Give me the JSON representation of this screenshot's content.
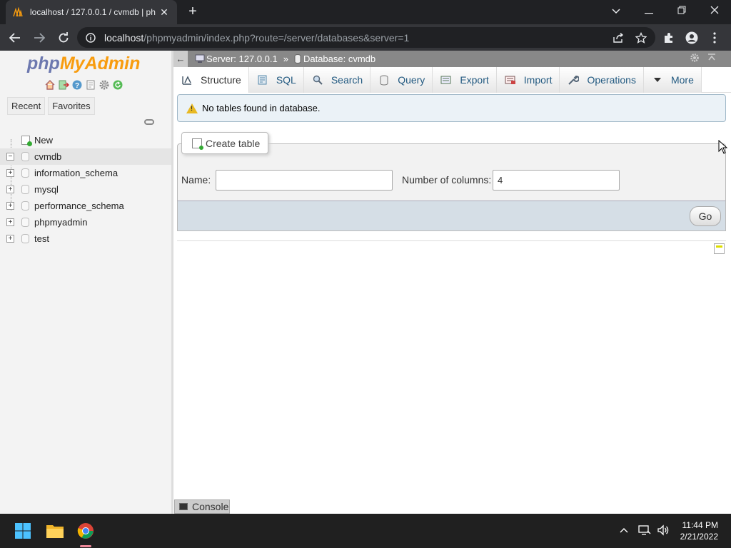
{
  "browser": {
    "tab_title": "localhost / 127.0.0.1 / cvmdb | ph",
    "tab_close": "✕",
    "new_tab": "+",
    "url_host": "localhost",
    "url_path": "/phpmyadmin/index.php?route=/server/databases&server=1",
    "window_controls": {
      "minimize": "—",
      "restore": "❐",
      "close": "✕",
      "dropdown": "⌄"
    }
  },
  "sidebar": {
    "logo": {
      "php": "php",
      "my": "My",
      "admin": "Admin"
    },
    "toolbar_icons": [
      "home-icon",
      "logout-icon",
      "help-icon",
      "docs-icon",
      "settings-icon",
      "reload-icon"
    ],
    "recent_tab": "Recent",
    "favorites_tab": "Favorites",
    "tree": [
      {
        "label": "New",
        "type": "new"
      },
      {
        "label": "cvmdb",
        "type": "db",
        "expanded": true,
        "selected": true
      },
      {
        "label": "information_schema",
        "type": "db"
      },
      {
        "label": "mysql",
        "type": "db"
      },
      {
        "label": "performance_schema",
        "type": "db"
      },
      {
        "label": "phpmyadmin",
        "type": "db"
      },
      {
        "label": "test",
        "type": "db"
      }
    ]
  },
  "breadcrumb": {
    "back": "←",
    "server": "Server: 127.0.0.1",
    "separator": "»",
    "database": "Database: cvmdb"
  },
  "tabs": [
    {
      "label": "Structure",
      "icon": "structure-icon",
      "active": true
    },
    {
      "label": "SQL",
      "icon": "sql-icon"
    },
    {
      "label": "Search",
      "icon": "search-icon"
    },
    {
      "label": "Query",
      "icon": "query-icon"
    },
    {
      "label": "Export",
      "icon": "export-icon"
    },
    {
      "label": "Import",
      "icon": "import-icon"
    },
    {
      "label": "Operations",
      "icon": "wrench-icon"
    },
    {
      "label": "More",
      "icon": "triangle-down-icon"
    }
  ],
  "notice": {
    "text": "No tables found in database."
  },
  "create_table": {
    "legend": "Create table",
    "name_label": "Name:",
    "name_value": "",
    "columns_label": "Number of columns:",
    "columns_value": "4",
    "go_button": "Go"
  },
  "console": {
    "label": "Console"
  },
  "taskbar": {
    "time": "11:44 PM",
    "date": "2/21/2022"
  },
  "colors": {
    "browser_dark": "#202124",
    "browser_toolbar": "#35363a",
    "pma_link": "#235a81",
    "logo_orange": "#f89c0e",
    "logo_blue": "#6c78af",
    "notice_bg": "#ebf2f7"
  }
}
